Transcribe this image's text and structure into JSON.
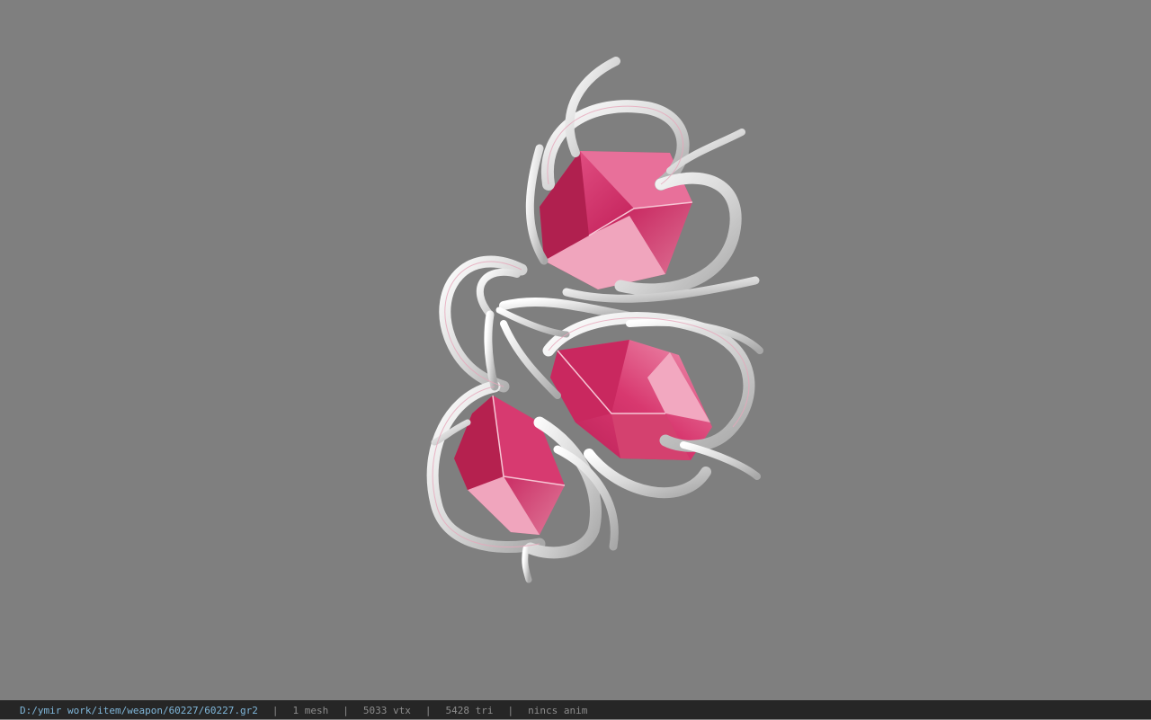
{
  "viewer": {
    "background_color": "#7f7f7f",
    "model": {
      "description_icon": "gem-weapon-model",
      "gem_color": "#d2396e",
      "metal_color": "#e6e6e6"
    }
  },
  "statusbar": {
    "file_path": "D:/ymir work/item/weapon/60227/60227.gr2",
    "separator": "|",
    "mesh_count": "1 mesh",
    "vertex_count": "5033 vtx",
    "triangle_count": "5428 tri",
    "anim_status": "nincs anim",
    "path_color": "#7fb6d9",
    "text_color": "#8c8c8c"
  }
}
